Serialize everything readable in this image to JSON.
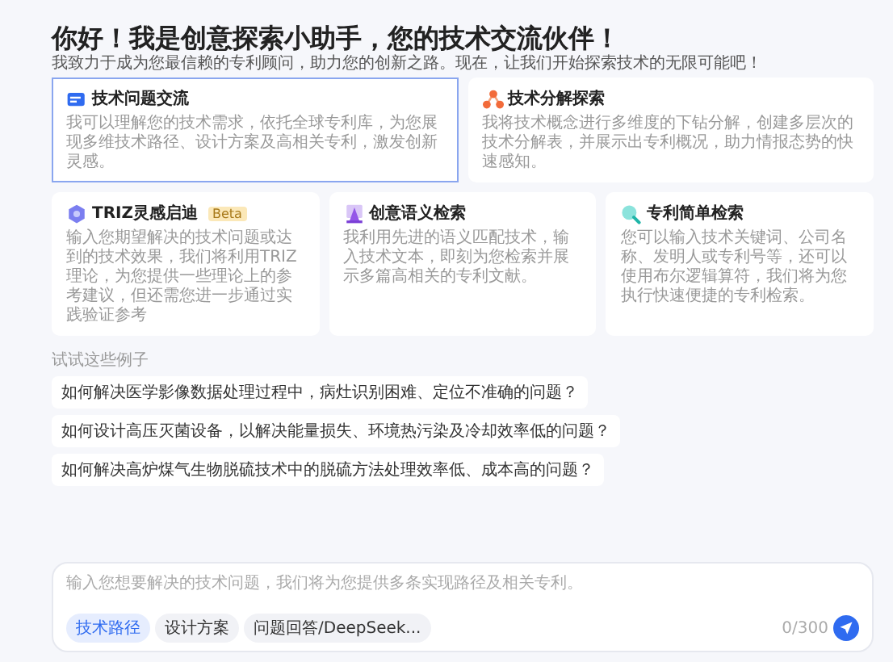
{
  "greeting": {
    "title": "你好！我是创意探索小助手，您的技术交流伙伴！",
    "subtitle": "我致力于成为您最信赖的专利顾问，助力您的创新之路。现在，让我们开始探索技术的无限可能吧！"
  },
  "cards": [
    {
      "title": "技术问题交流",
      "selected": true,
      "description": "我可以理解您的技术需求，依托全球专利库，为您展现多维技术路径、设计方案及高相关专利，激发创新灵感。"
    },
    {
      "title": "技术分解探索",
      "selected": false,
      "description": "我将技术概念进行多维度的下钻分解，创建多层次的技术分解表，并展示出专利概况，助力情报态势的快速感知。"
    },
    {
      "title": "TRIZ灵感启迪",
      "badge": "Beta",
      "selected": false,
      "description": "输入您期望解决的技术问题或达到的技术效果，我们将利用TRIZ理论，为您提供一些理论上的参考建议，但还需您进一步通过实践验证参考"
    },
    {
      "title": "创意语义检索",
      "selected": false,
      "description": "我利用先进的语义匹配技术，输入技术文本，即刻为您检索并展示多篇高相关的专利文献。"
    },
    {
      "title": "专利简单检索",
      "selected": false,
      "description": "您可以输入技术关键词、公司名称、发明人或专利号等，还可以使用布尔逻辑算符，我们将为您执行快速便捷的专利检索。"
    }
  ],
  "examples": {
    "label": "试试这些例子",
    "items": [
      "如何解决医学影像数据处理过程中，病灶识别困难、定位不准确的问题？",
      "如何设计高压灭菌设备，以解决能量损失、环境热污染及冷却效率低的问题？",
      "如何解决高炉煤气生物脱硫技术中的脱硫方法处理效率低、成本高的问题？"
    ]
  },
  "input": {
    "placeholder": "输入您想要解决的技术问题，我们将为您提供多条实现路径及相关专利。",
    "chips": [
      {
        "label": "技术路径",
        "selected": true
      },
      {
        "label": "设计方案",
        "selected": false
      },
      {
        "label": "问题回答/DeepSeek...",
        "selected": false
      }
    ],
    "counter": "0/300"
  }
}
